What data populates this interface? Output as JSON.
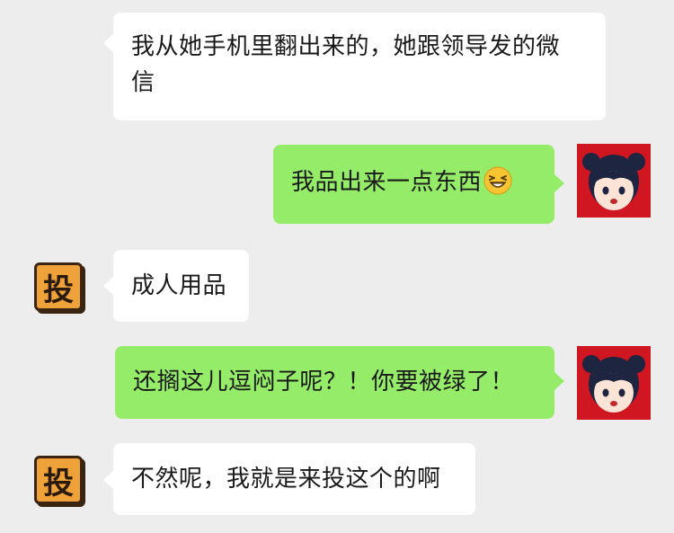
{
  "messages": [
    {
      "sender": "other",
      "avatar_text": "",
      "text": "我从她手机里翻出来的，她跟领导发的微信"
    },
    {
      "sender": "me",
      "text": "我品出来一点东西",
      "emoji": "grinning-squint-emoji"
    },
    {
      "sender": "other",
      "avatar_text": "投",
      "text": "成人用品"
    },
    {
      "sender": "me",
      "text": "还搁这儿逗闷子呢？！你要被绿了！"
    },
    {
      "sender": "other",
      "avatar_text": "投",
      "text": "不然呢，我就是来投这个的啊"
    }
  ],
  "colors": {
    "background": "#ededed",
    "bubble_other": "#ffffff",
    "bubble_me": "#95ec69",
    "avatar_tou": "#f0a23a",
    "avatar_girl_bg": "#d01620"
  }
}
